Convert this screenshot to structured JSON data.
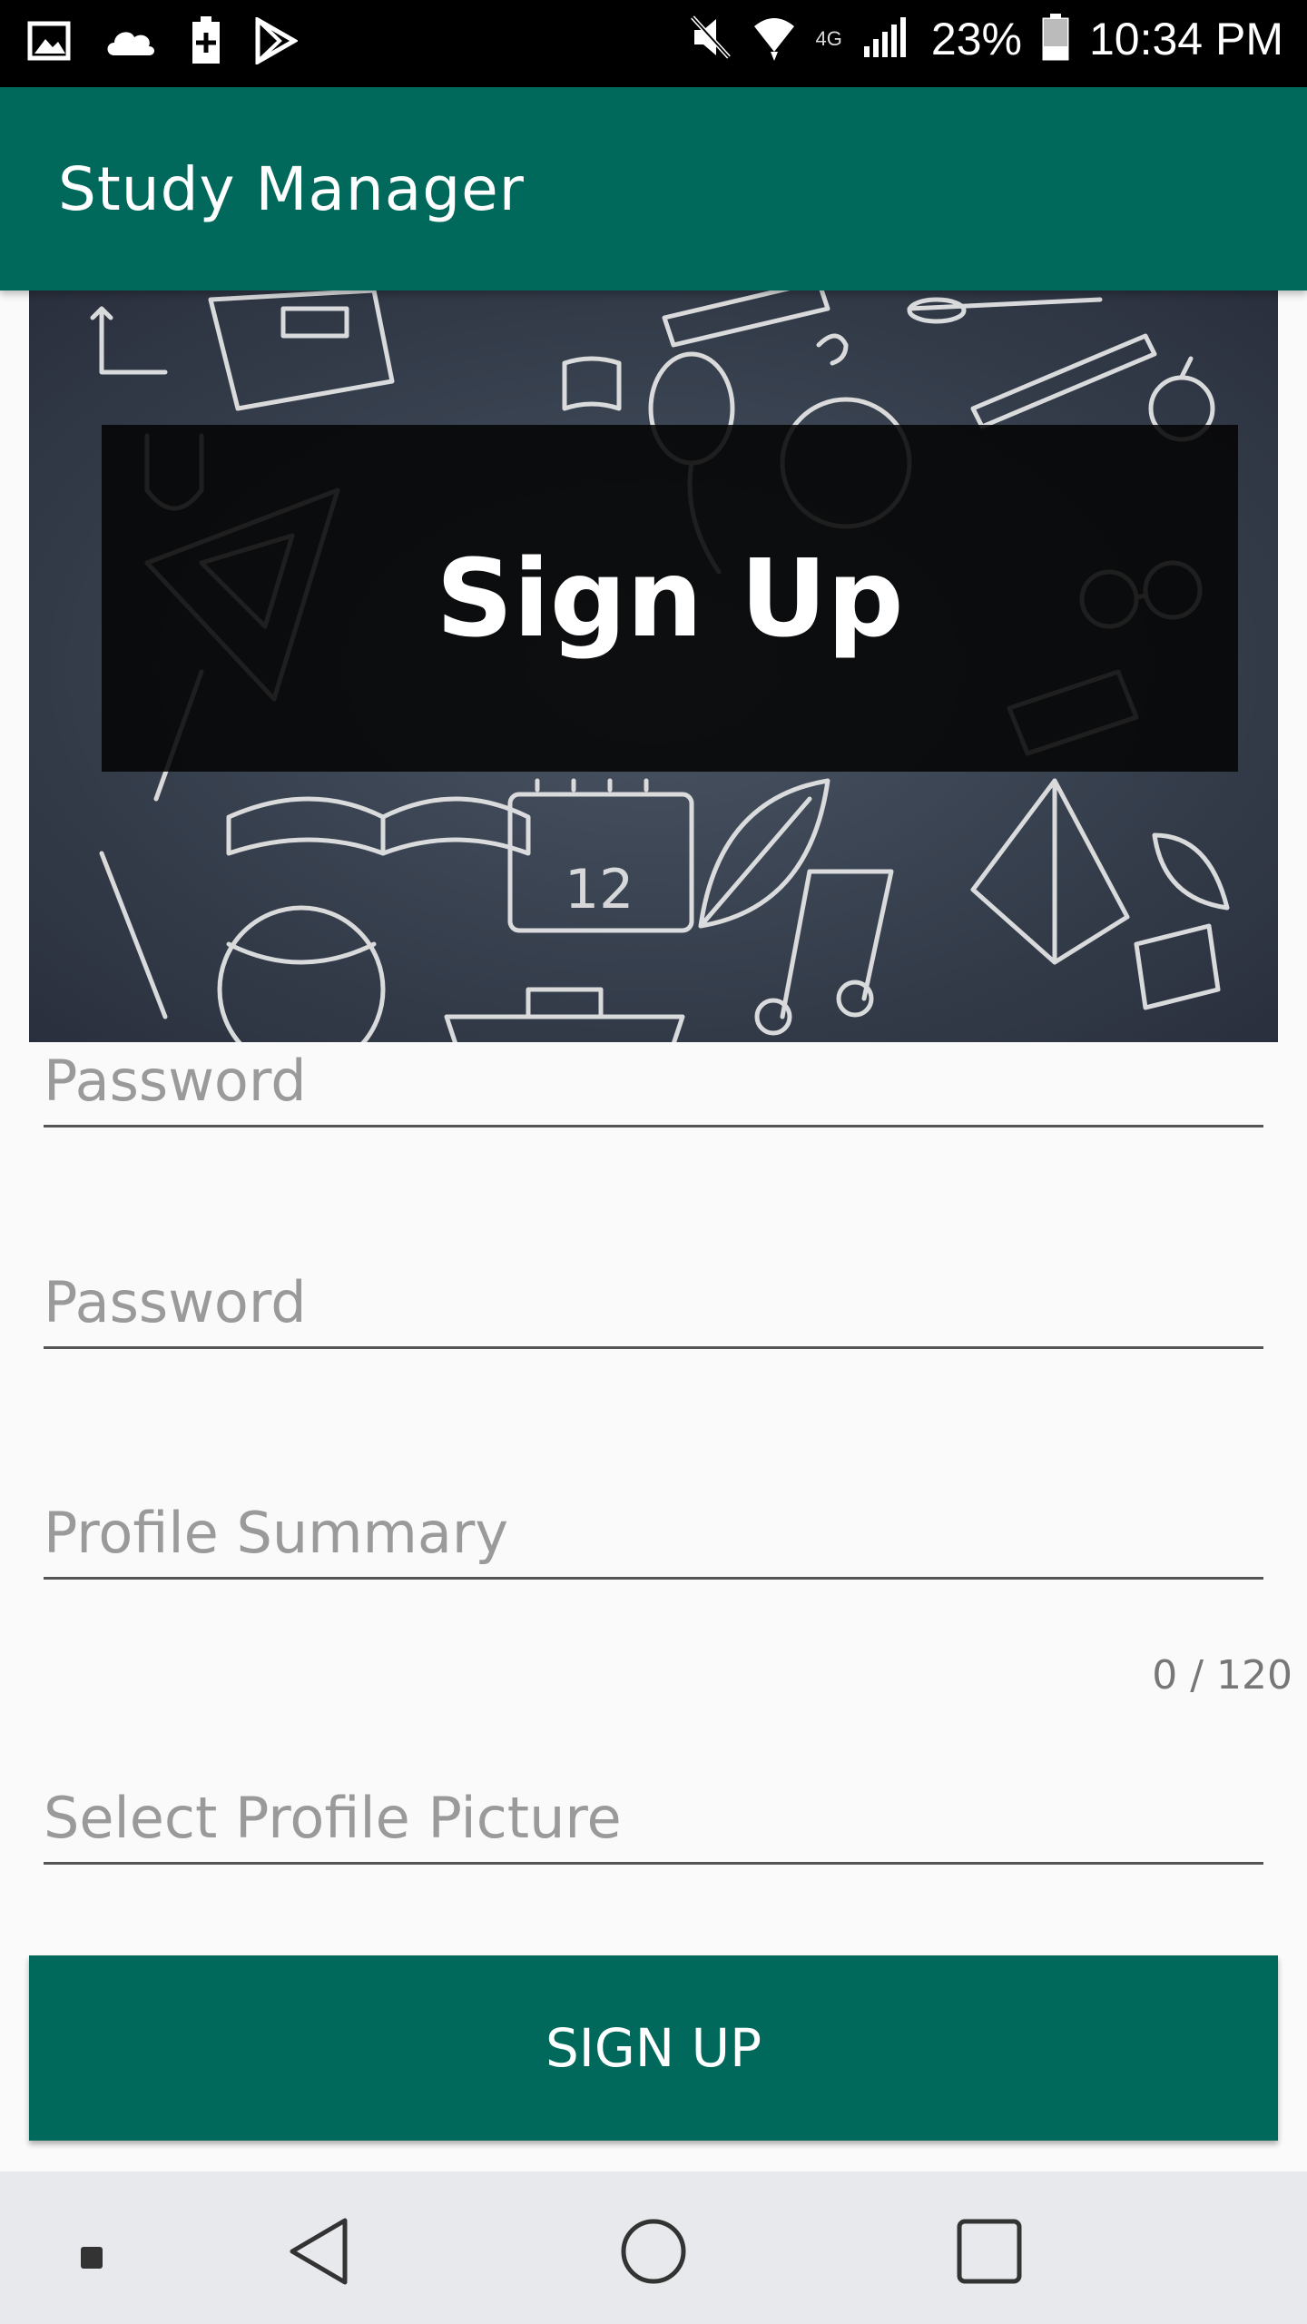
{
  "status_bar": {
    "battery_percent": "23%",
    "time": "10:34 PM",
    "network": "4G",
    "icons_left": [
      "gallery-icon",
      "cloud-icon",
      "battery-saver-icon",
      "play-store-icon"
    ],
    "icons_right": [
      "mute-icon",
      "wifi-icon",
      "signal-icon",
      "battery-icon"
    ]
  },
  "app_bar": {
    "title": "Study Manager",
    "color": "#00695c"
  },
  "banner": {
    "title": "Sign Up",
    "calendar_number": "12"
  },
  "form": {
    "password_placeholder": "Password",
    "confirm_password_placeholder": "Password",
    "profile_summary_placeholder": "Profile Summary",
    "profile_summary_counter": "0 / 120",
    "profile_picture_placeholder": "Select Profile Picture"
  },
  "signup_button": {
    "label": "SIGN UP"
  },
  "nav_bar": {
    "icons": [
      "menu-dot-icon",
      "back-icon",
      "home-icon",
      "recents-icon"
    ]
  }
}
